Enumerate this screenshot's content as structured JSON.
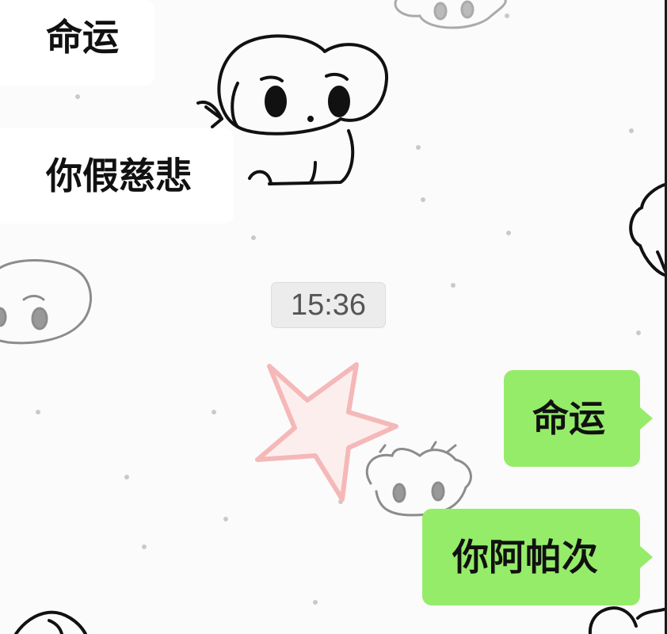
{
  "chat": {
    "messages": [
      {
        "sender": "other",
        "text": "命运"
      },
      {
        "sender": "other",
        "text": "你假慈悲"
      },
      {
        "sender": "self",
        "text": "命运"
      },
      {
        "sender": "self",
        "text": "你阿帕次"
      }
    ],
    "timestamp": "15:36"
  },
  "colors": {
    "incoming_bubble": "#ffffff",
    "outgoing_bubble": "#95ec69",
    "timestamp_pill": "#ececec",
    "background": "#fbfbfb"
  },
  "icons": [
    "dog-doodle-icon",
    "star-doodle-icon"
  ]
}
